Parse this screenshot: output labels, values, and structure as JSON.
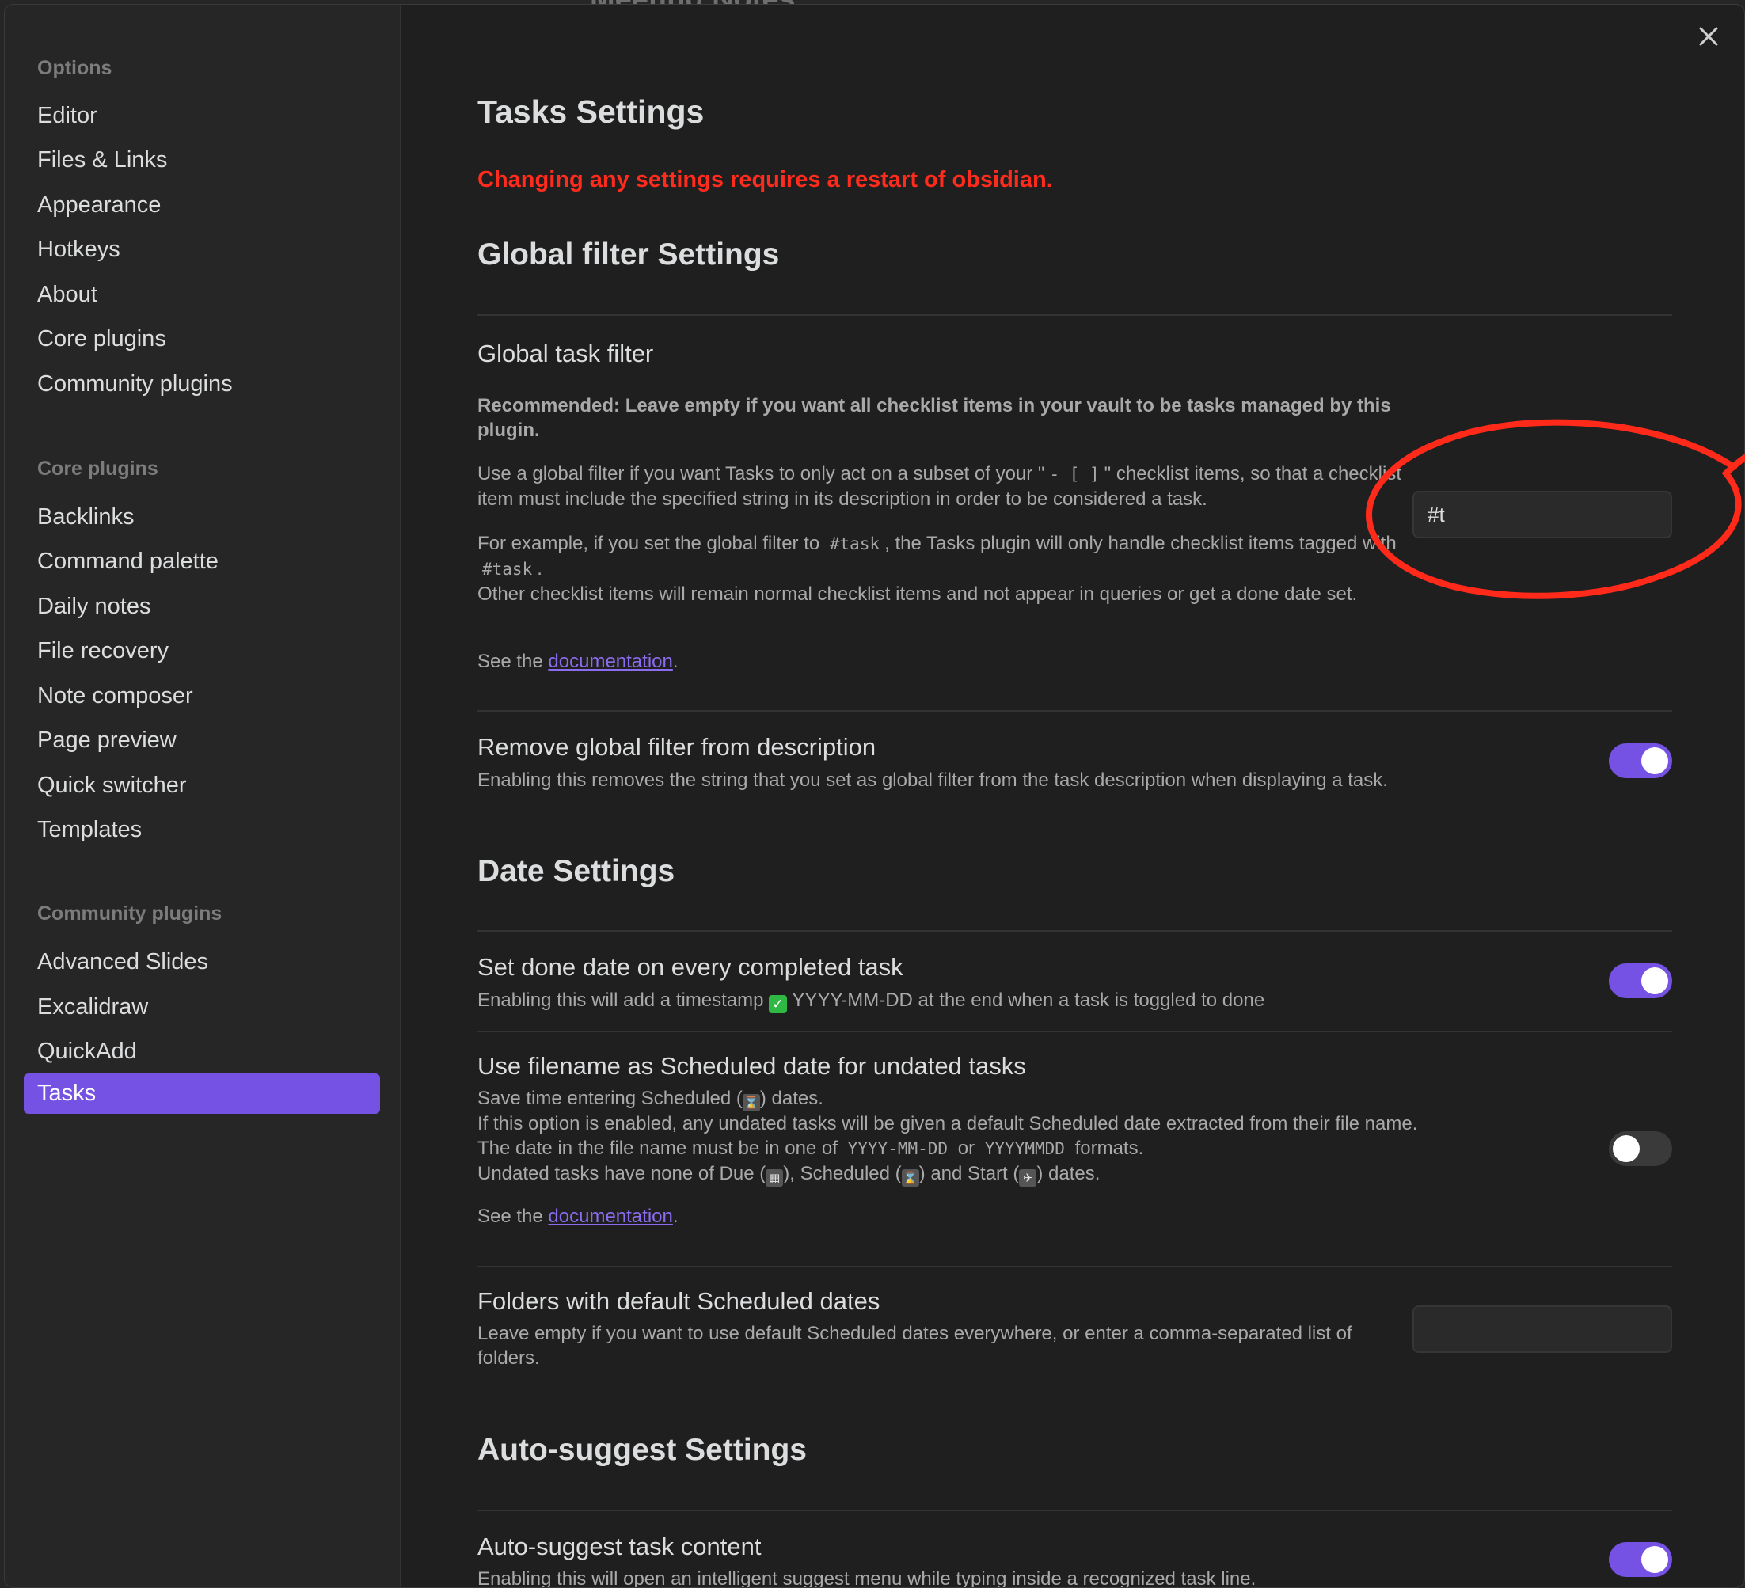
{
  "background_note_title": "Meeting Notes",
  "sidebar": {
    "sections": [
      {
        "header": "Options",
        "items": [
          "Editor",
          "Files & Links",
          "Appearance",
          "Hotkeys",
          "About",
          "Core plugins",
          "Community plugins"
        ]
      },
      {
        "header": "Core plugins",
        "items": [
          "Backlinks",
          "Command palette",
          "Daily notes",
          "File recovery",
          "Note composer",
          "Page preview",
          "Quick switcher",
          "Templates"
        ]
      },
      {
        "header": "Community plugins",
        "items": [
          "Advanced Slides",
          "Excalidraw",
          "QuickAdd",
          "Tasks"
        ]
      }
    ],
    "active_item": "Tasks"
  },
  "close_label": "✕",
  "main": {
    "title": "Tasks Settings",
    "restart_warning": "Changing any settings requires a restart of obsidian.",
    "global_filter": {
      "heading": "Global filter Settings",
      "name": "Global task filter",
      "recommended": "Recommended: Leave empty if you want all checklist items in your vault to be tasks managed by this plugin.",
      "desc1_part1": "Use a global filter if you want Tasks to only act on a subset of your \"",
      "desc1_code": "- [ ]",
      "desc1_part2": "\" checklist items, so that a checklist item must include the specified string in its description in order to be considered a task.",
      "desc2_part1": "For example, if you set the global filter to",
      "desc2_code1": "#task",
      "desc2_part2": ", the Tasks plugin will only handle checklist items tagged with",
      "desc2_code2": "#task",
      "desc2_part3": ".",
      "desc3": "Other checklist items will remain normal checklist items and not appear in queries or get a done date set.",
      "see_prefix": "See the",
      "see_link": "documentation",
      "see_suffix": ".",
      "input_value": "#t"
    },
    "remove_filter": {
      "name": "Remove global filter from description",
      "desc": "Enabling this removes the string that you set as global filter from the task description when displaying a task.",
      "enabled": true
    },
    "date_settings": {
      "heading": "Date Settings",
      "done_date": {
        "name": "Set done date on every completed task",
        "desc_prefix": "Enabling this will add a timestamp",
        "desc_suffix": "YYYY-MM-DD at the end when a task is toggled to done",
        "enabled": true
      },
      "filename_scheduled": {
        "name": "Use filename as Scheduled date for undated tasks",
        "line1_prefix": "Save time entering Scheduled (",
        "line1_suffix": ") dates.",
        "line2": "If this option is enabled, any undated tasks will be given a default Scheduled date extracted from their file name.",
        "line3_prefix": "The date in the file name must be in one of",
        "line3_code1": "YYYY-MM-DD",
        "line3_or": "or",
        "line3_code2": "YYYYMMDD",
        "line3_suffix": "formats.",
        "line4_prefix": "Undated tasks have none of Due (",
        "line4_mid1": "), Scheduled (",
        "line4_mid2": ") and Start (",
        "line4_suffix": ") dates.",
        "see_prefix": "See the",
        "see_link": "documentation",
        "see_suffix": ".",
        "enabled": false
      },
      "folders": {
        "name": "Folders with default Scheduled dates",
        "desc": "Leave empty if you want to use default Scheduled dates everywhere, or enter a comma-separated list of folders.",
        "input_value": ""
      }
    },
    "auto_suggest": {
      "heading": "Auto-suggest Settings",
      "content": {
        "name": "Auto-suggest task content",
        "desc": "Enabling this will open an intelligent suggest menu while typing inside a recognized task line.",
        "enabled": true
      }
    }
  },
  "colors": {
    "accent": "#7552e3",
    "warning": "#ff2b1d",
    "annotation": "#ff2a1a",
    "modal_bg": "#1f1f1f",
    "sidebar_bg": "#262626"
  },
  "icons": {
    "close": "close-icon",
    "check": "white-check-mark-emoji",
    "scheduled": "hourglass-emoji",
    "due": "calendar-emoji",
    "start": "airplane-departure-emoji"
  }
}
